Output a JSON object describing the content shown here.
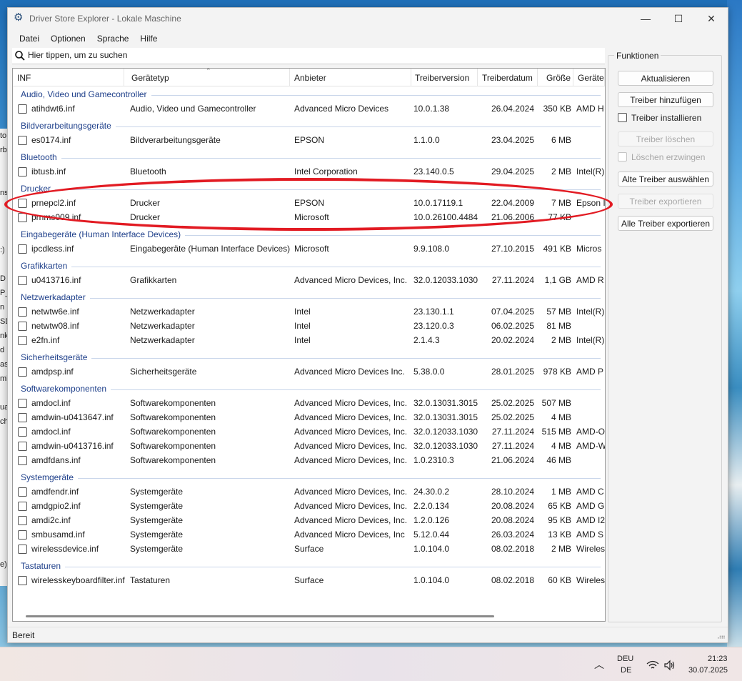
{
  "window": {
    "title": "Driver Store Explorer - Lokale Maschine",
    "minimize": "—",
    "maximize": "☐",
    "close": "✕"
  },
  "menu": [
    "Datei",
    "Optionen",
    "Sprache",
    "Hilfe"
  ],
  "search": {
    "placeholder": "Hier tippen, um zu suchen",
    "value": ""
  },
  "columns": [
    "INF",
    "Gerätetyp",
    "Anbieter",
    "Treiberversion",
    "Treiberdatum",
    "Größe",
    "Geräte"
  ],
  "groups": [
    {
      "name": "Audio, Video und Gamecontroller",
      "rows": [
        {
          "inf": "atihdwt6.inf",
          "type": "Audio, Video und Gamecontroller",
          "vendor": "Advanced Micro Devices",
          "version": "10.0.1.38",
          "date": "26.04.2024",
          "size": "350 KB",
          "device": "AMD H"
        }
      ]
    },
    {
      "name": "Bildverarbeitungsgeräte",
      "rows": [
        {
          "inf": "es0174.inf",
          "type": "Bildverarbeitungsgeräte",
          "vendor": "EPSON",
          "version": "1.1.0.0",
          "date": "23.04.2025",
          "size": "6 MB",
          "device": ""
        }
      ]
    },
    {
      "name": "Bluetooth",
      "rows": [
        {
          "inf": "ibtusb.inf",
          "type": "Bluetooth",
          "vendor": "Intel Corporation",
          "version": "23.140.0.5",
          "date": "29.04.2025",
          "size": "2 MB",
          "device": "Intel(R)"
        }
      ]
    },
    {
      "name": "Drucker",
      "rows": [
        {
          "inf": "prnepcl2.inf",
          "type": "Drucker",
          "vendor": "EPSON",
          "version": "10.0.17119.1",
          "date": "22.04.2009",
          "size": "7 MB",
          "device": "Epson I"
        },
        {
          "inf": "prnms009.inf",
          "type": "Drucker",
          "vendor": "Microsoft",
          "version": "10.0.26100.4484",
          "date": "21.06.2006",
          "size": "77 KB",
          "device": ""
        }
      ]
    },
    {
      "name": "Eingabegeräte (Human Interface Devices)",
      "rows": [
        {
          "inf": "ipcdless.inf",
          "type": "Eingabegeräte (Human Interface Devices)",
          "vendor": "Microsoft",
          "version": "9.9.108.0",
          "date": "27.10.2015",
          "size": "491 KB",
          "device": "Micros"
        }
      ]
    },
    {
      "name": "Grafikkarten",
      "rows": [
        {
          "inf": "u0413716.inf",
          "type": "Grafikkarten",
          "vendor": "Advanced Micro Devices, Inc.",
          "version": "32.0.12033.1030",
          "date": "27.11.2024",
          "size": "1,1 GB",
          "device": "AMD R"
        }
      ]
    },
    {
      "name": "Netzwerkadapter",
      "rows": [
        {
          "inf": "netwtw6e.inf",
          "type": "Netzwerkadapter",
          "vendor": "Intel",
          "version": "23.130.1.1",
          "date": "07.04.2025",
          "size": "57 MB",
          "device": "Intel(R)"
        },
        {
          "inf": "netwtw08.inf",
          "type": "Netzwerkadapter",
          "vendor": "Intel",
          "version": "23.120.0.3",
          "date": "06.02.2025",
          "size": "81 MB",
          "device": ""
        },
        {
          "inf": "e2fn.inf",
          "type": "Netzwerkadapter",
          "vendor": "Intel",
          "version": "2.1.4.3",
          "date": "20.02.2024",
          "size": "2 MB",
          "device": "Intel(R)"
        }
      ]
    },
    {
      "name": "Sicherheitsgeräte",
      "rows": [
        {
          "inf": "amdpsp.inf",
          "type": "Sicherheitsgeräte",
          "vendor": "Advanced Micro Devices Inc.",
          "version": "5.38.0.0",
          "date": "28.01.2025",
          "size": "978 KB",
          "device": "AMD P"
        }
      ]
    },
    {
      "name": "Softwarekomponenten",
      "rows": [
        {
          "inf": "amdocl.inf",
          "type": "Softwarekomponenten",
          "vendor": "Advanced Micro Devices, Inc.",
          "version": "32.0.13031.3015",
          "date": "25.02.2025",
          "size": "507 MB",
          "device": ""
        },
        {
          "inf": "amdwin-u0413647.inf",
          "type": "Softwarekomponenten",
          "vendor": "Advanced Micro Devices, Inc.",
          "version": "32.0.13031.3015",
          "date": "25.02.2025",
          "size": "4 MB",
          "device": ""
        },
        {
          "inf": "amdocl.inf",
          "type": "Softwarekomponenten",
          "vendor": "Advanced Micro Devices, Inc.",
          "version": "32.0.12033.1030",
          "date": "27.11.2024",
          "size": "515 MB",
          "device": "AMD-O"
        },
        {
          "inf": "amdwin-u0413716.inf",
          "type": "Softwarekomponenten",
          "vendor": "Advanced Micro Devices, Inc.",
          "version": "32.0.12033.1030",
          "date": "27.11.2024",
          "size": "4 MB",
          "device": "AMD-W"
        },
        {
          "inf": "amdfdans.inf",
          "type": "Softwarekomponenten",
          "vendor": "Advanced Micro Devices, Inc.",
          "version": "1.0.2310.3",
          "date": "21.06.2024",
          "size": "46 MB",
          "device": ""
        }
      ]
    },
    {
      "name": "Systemgeräte",
      "rows": [
        {
          "inf": "amdfendr.inf",
          "type": "Systemgeräte",
          "vendor": "Advanced Micro Devices, Inc.",
          "version": "24.30.0.2",
          "date": "28.10.2024",
          "size": "1 MB",
          "device": "AMD C"
        },
        {
          "inf": "amdgpio2.inf",
          "type": "Systemgeräte",
          "vendor": "Advanced Micro Devices, Inc.",
          "version": "2.2.0.134",
          "date": "20.08.2024",
          "size": "65 KB",
          "device": "AMD G"
        },
        {
          "inf": "amdi2c.inf",
          "type": "Systemgeräte",
          "vendor": "Advanced Micro Devices, Inc.",
          "version": "1.2.0.126",
          "date": "20.08.2024",
          "size": "95 KB",
          "device": "AMD I2"
        },
        {
          "inf": "smbusamd.inf",
          "type": "Systemgeräte",
          "vendor": "Advanced Micro Devices, Inc",
          "version": "5.12.0.44",
          "date": "26.03.2024",
          "size": "13 KB",
          "device": "AMD S"
        },
        {
          "inf": "wirelessdevice.inf",
          "type": "Systemgeräte",
          "vendor": "Surface",
          "version": "1.0.104.0",
          "date": "08.02.2018",
          "size": "2 MB",
          "device": "Wireles"
        }
      ]
    },
    {
      "name": "Tastaturen",
      "rows": [
        {
          "inf": "wirelesskeyboardfilter.inf",
          "type": "Tastaturen",
          "vendor": "Surface",
          "version": "1.0.104.0",
          "date": "08.02.2018",
          "size": "60 KB",
          "device": "Wireles"
        }
      ]
    }
  ],
  "panel": {
    "title": "Funktionen",
    "refresh": "Aktualisieren",
    "add_driver": "Treiber hinzufügen",
    "install_driver": "Treiber installieren",
    "delete_driver": "Treiber löschen",
    "force_delete": "Löschen erzwingen",
    "select_old": "Alte Treiber auswählen",
    "export_driver": "Treiber exportieren",
    "export_all": "Alle Treiber exportieren"
  },
  "status": "Bereit",
  "taskbar": {
    "lang1": "DEU",
    "lang2": "DE",
    "time": "21:23",
    "date": "30.07.2025"
  },
  "background_fragments": [
    "to",
    "rb",
    "",
    "",
    "ns",
    "",
    "",
    "",
    ":)",
    "",
    "D",
    "P_",
    "n",
    "SD",
    "nk",
    "d",
    "as",
    "ml",
    "",
    "ua",
    "ch",
    "",
    "",
    "",
    "",
    "",
    "",
    "",
    "",
    "",
    "e)"
  ],
  "colors": {
    "group_header": "#1e3f8a",
    "highlight": "#e21b23"
  }
}
